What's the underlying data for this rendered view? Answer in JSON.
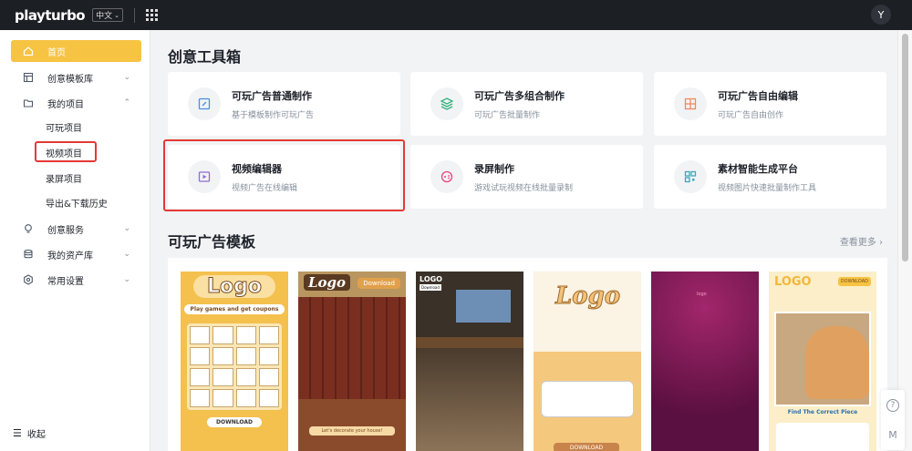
{
  "topbar": {
    "logo": "playturbo",
    "lang": "中文",
    "avatar": "Y"
  },
  "sidebar": {
    "items": [
      {
        "label": "首页",
        "icon": "home-icon"
      },
      {
        "label": "创意模板库",
        "icon": "template-icon"
      },
      {
        "label": "我的项目",
        "icon": "folder-icon"
      },
      {
        "label": "创意服务",
        "icon": "bulb-icon"
      },
      {
        "label": "我的资产库",
        "icon": "database-icon"
      },
      {
        "label": "常用设置",
        "icon": "gear-icon"
      }
    ],
    "sub_items": [
      "可玩项目",
      "视频项目",
      "录屏项目",
      "导出&下载历史"
    ],
    "collapse": "收起"
  },
  "main": {
    "toolbox_title": "创意工具箱",
    "cards": [
      {
        "title": "可玩广告普通制作",
        "desc": "基于模板制作可玩广告"
      },
      {
        "title": "可玩广告多组合制作",
        "desc": "可玩广告批量制作"
      },
      {
        "title": "可玩广告自由编辑",
        "desc": "可玩广告自由创作"
      },
      {
        "title": "视频编辑器",
        "desc": "视频广告在线编辑"
      },
      {
        "title": "录屏制作",
        "desc": "游戏试玩视频在线批量录制"
      },
      {
        "title": "素材智能生成平台",
        "desc": "视频图片快速批量制作工具"
      }
    ],
    "templates_title": "可玩广告模板",
    "more": "查看更多 ›",
    "templates": [
      {
        "logo": "Logo",
        "text": "Play games and get coupons",
        "button": "DOWNLOAD"
      },
      {
        "logo": "Logo",
        "button": "Download",
        "text": "Let's decorate your house!"
      },
      {
        "logo": "LOGO",
        "button": "Download"
      },
      {
        "logo": "Logo",
        "button": "DOWNLOAD"
      },
      {
        "logo": "logo"
      },
      {
        "logo": "LOGO",
        "button": "DOWNLOAD",
        "text": "Find The Correct Piece"
      }
    ]
  },
  "colors": {
    "accent": "#f6c343",
    "highlight": "#e53935",
    "topbar": "#1c1f24"
  }
}
